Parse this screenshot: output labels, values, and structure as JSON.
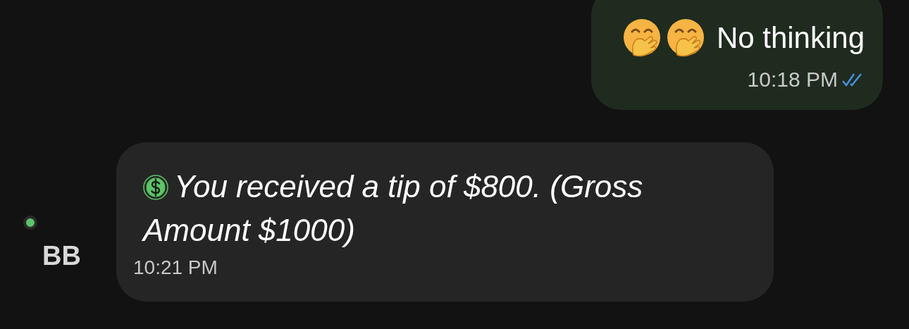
{
  "messages": [
    {
      "kind": "outgoing",
      "emojis": [
        {
          "kind": "hand-over-mouth"
        },
        {
          "kind": "hand-over-mouth"
        }
      ],
      "text": "No thinking",
      "time": "10:18 PM",
      "read": true
    },
    {
      "kind": "tip",
      "sender": {
        "initials": "BB",
        "online": true
      },
      "text": "You received a tip of $800. (Gross Amount $1000)",
      "time": "10:21 PM"
    }
  ]
}
